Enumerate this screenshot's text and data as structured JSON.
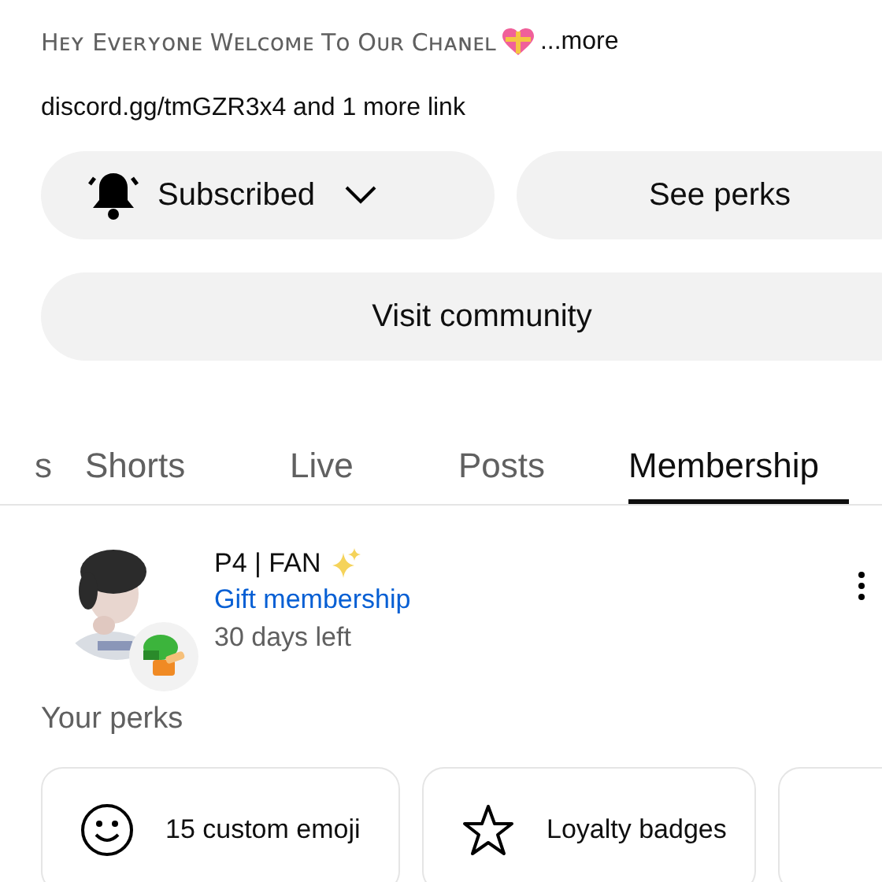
{
  "description": {
    "text": "Hᴇʏ Eᴠᴇʀʏᴏɴᴇ Wᴇʟᴄᴏᴍᴇ Tᴏ Oᴜʀ Cʜᴀɴᴇʟ",
    "more": "...more"
  },
  "links": "discord.gg/tmGZR3x4 and 1 more link",
  "buttons": [
    {
      "kind": "subscribed",
      "label": "Subscribed"
    },
    {
      "kind": "plain",
      "label": "See perks"
    }
  ],
  "community_button": "Visit community",
  "tabs": [
    {
      "label": "s",
      "selected": false
    },
    {
      "label": "Shorts",
      "selected": false
    },
    {
      "label": "Live",
      "selected": false
    },
    {
      "label": "Posts",
      "selected": false
    },
    {
      "label": "Membership",
      "selected": true
    }
  ],
  "membership": {
    "level": "P4 | FAN",
    "gift": "Gift membership",
    "remaining": "30 days left"
  },
  "perks_heading": "Your perks",
  "perks": [
    {
      "kind": "emoji",
      "label": "15 custom emoji"
    },
    {
      "kind": "badge",
      "label": "Loyalty badges"
    },
    {
      "kind": "empty"
    }
  ]
}
